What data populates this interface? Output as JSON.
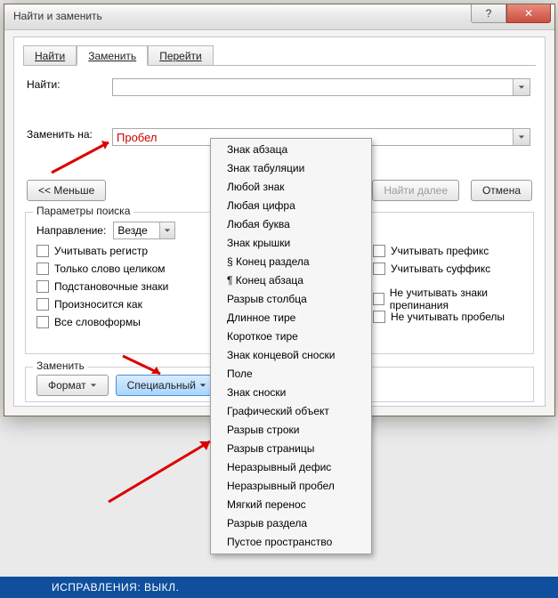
{
  "window": {
    "title": "Найти и заменить",
    "help_symbol": "?",
    "close_symbol": "✕"
  },
  "tabs": {
    "find": "Найти",
    "replace": "Заменить",
    "goto": "Перейти"
  },
  "labels": {
    "find_what": "Найти:",
    "replace_with": "Заменить на:",
    "search_params": "Параметры поиска",
    "direction": "Направление:",
    "replace_section": "Заменить"
  },
  "values": {
    "find_value": "",
    "replace_value": "Пробел",
    "direction_value": "Везде"
  },
  "buttons": {
    "less": "<< Меньше",
    "find_next": "Найти далее",
    "cancel": "Отмена",
    "format": "Формат",
    "special": "Специальный"
  },
  "checks_left": [
    "Учитывать регистр",
    "Только слово целиком",
    "Подстановочные знаки",
    "Произносится как",
    "Все словоформы"
  ],
  "checks_right": [
    "Учитывать префикс",
    "Учитывать суффикс",
    "Не учитывать знаки препинания",
    "Не учитывать пробелы"
  ],
  "menu_items": [
    "Знак абзаца",
    "Знак табуляции",
    "Любой знак",
    "Любая цифра",
    "Любая буква",
    "Знак крышки",
    "§ Конец раздела",
    "¶ Конец абзаца",
    "Разрыв столбца",
    "Длинное тире",
    "Короткое тире",
    "Знак концевой сноски",
    "Поле",
    "Знак сноски",
    "Графический объект",
    "Разрыв строки",
    "Разрыв страницы",
    "Неразрывный дефис",
    "Неразрывный пробел",
    "Мягкий перенос",
    "Разрыв раздела",
    "Пустое пространство"
  ],
  "statusbar": "ИСПРАВЛЕНИЯ: ВЫКЛ."
}
